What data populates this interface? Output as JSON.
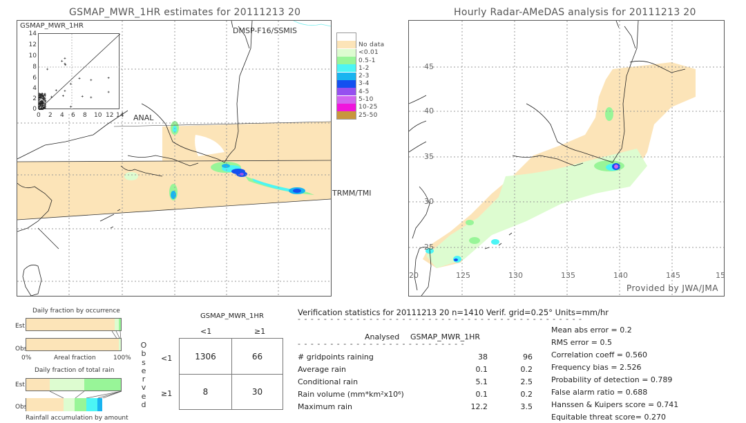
{
  "left_panel": {
    "title": "GSMAP_MWR_1HR estimates for 20111213 20",
    "overpass_labels": [
      "DMSP-F16/SSMIS",
      "ANAL",
      "TRMM/TMI"
    ],
    "inset_scatter": {
      "title": "GSMAP_MWR_1HR",
      "y_ticks": [
        "14",
        "12",
        "10",
        "8",
        "6",
        "4",
        "2",
        "0"
      ],
      "x_ticks": [
        "0",
        "2",
        "4",
        "6",
        "8",
        "10",
        "12",
        "14"
      ]
    }
  },
  "right_panel": {
    "title": "Hourly Radar-AMeDAS analysis for 20111213 20",
    "lat_labels": [
      "45",
      "40",
      "35",
      "30",
      "25"
    ],
    "lon_labels": [
      "20",
      "125",
      "130",
      "135",
      "140",
      "145",
      "15"
    ],
    "credit": "Provided by JWA/JMA"
  },
  "legend": {
    "items": [
      {
        "label": "",
        "color": "#ffffff"
      },
      {
        "label": "No data",
        "color": "#fce4b8"
      },
      {
        "label": "<0.01",
        "color": "#ddfcd0"
      },
      {
        "label": "0.5-1",
        "color": "#98f598"
      },
      {
        "label": "1-2",
        "color": "#4cf5f5"
      },
      {
        "label": "2-3",
        "color": "#19b4f0"
      },
      {
        "label": "3-4",
        "color": "#1450f0"
      },
      {
        "label": "4-5",
        "color": "#9650f0"
      },
      {
        "label": "5-10",
        "color": "#d264f0"
      },
      {
        "label": "10-25",
        "color": "#f014dc"
      },
      {
        "label": "25-50",
        "color": "#c8963c"
      }
    ]
  },
  "occurrence_chart": {
    "title": "Daily fraction by occurrence",
    "row_labels": [
      "Est",
      "Obs"
    ],
    "x_left": "0%",
    "x_center": "Areal fraction",
    "x_right": "100%",
    "est_fractions": [
      0.935,
      0.04,
      0.025
    ],
    "obs_fractions": [
      0.975,
      0.025
    ]
  },
  "rain_chart": {
    "title": "Daily fraction of total rain",
    "row_labels": [
      "Est",
      "Obs"
    ],
    "caption": "Rainfall accumulation by amount",
    "est_fractions": [
      0.25,
      0.36,
      0.39
    ],
    "obs_fractions": [
      0.39,
      0.12,
      0.12,
      0.12,
      0.05
    ]
  },
  "contingency": {
    "header": "GSMAP_MWR_1HR",
    "col_labels": [
      "<1",
      "≥1"
    ],
    "row_labels": [
      "<1",
      "≥1"
    ],
    "side_label": "Observed",
    "cells": [
      [
        "1306",
        "66"
      ],
      [
        "8",
        "30"
      ]
    ]
  },
  "stats": {
    "header": "Verification statistics for 20111213 20   n=1410   Verif. grid=0.25°   Units=mm/hr",
    "col_analysed": "Analysed",
    "col_gsmap": "GSMAP_MWR_1HR",
    "rows": [
      {
        "label": "# gridpoints raining",
        "analysed": "38",
        "gsmap": "96"
      },
      {
        "label": "Average rain",
        "analysed": "0.1",
        "gsmap": "0.2"
      },
      {
        "label": "Conditional rain",
        "analysed": "5.1",
        "gsmap": "2.5"
      },
      {
        "label": "Rain volume (mm*km²x10⁶)",
        "analysed": "0.1",
        "gsmap": "0.2"
      },
      {
        "label": "Maximum rain",
        "analysed": "12.2",
        "gsmap": "3.5"
      }
    ],
    "scores": [
      "Mean abs error = 0.2",
      "RMS error = 0.5",
      "Correlation coeff = 0.560",
      "Frequency bias = 2.526",
      "Probability of detection = 0.789",
      "False alarm ratio = 0.688",
      "Hanssen & Kuipers score = 0.741",
      "Equitable threat score= 0.270"
    ]
  }
}
